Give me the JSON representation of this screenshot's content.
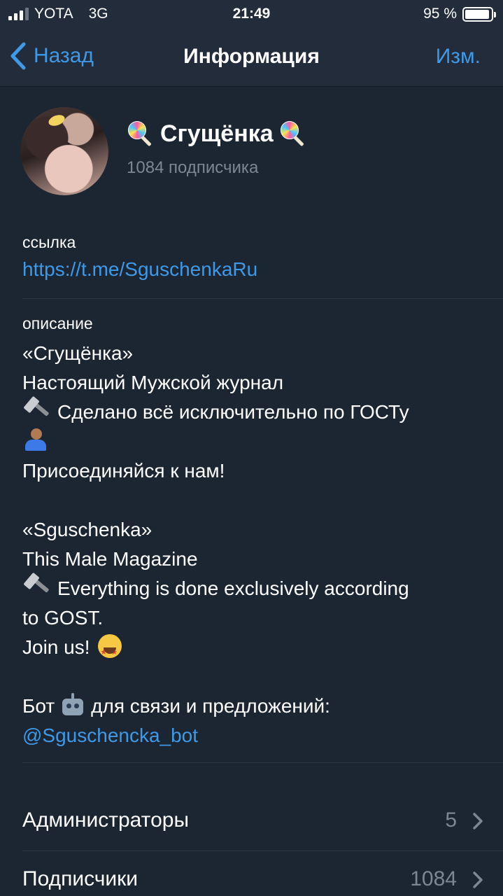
{
  "status_bar": {
    "carrier": "YOTA",
    "network": "3G",
    "time": "21:49",
    "battery_text": "95 %",
    "battery_level": 0.95,
    "signal_bars_filled": 3,
    "signal_bars_total": 4
  },
  "nav": {
    "back_label": "Назад",
    "title": "Информация",
    "edit_label": "Изм."
  },
  "channel": {
    "name": "Сгущёнка",
    "name_emoji_icon": "lollipop-icon",
    "subscribers_text": "1084 подписчика"
  },
  "link_section": {
    "label": "ссылка",
    "url": "https://t.me/SguschenkaRu"
  },
  "description_section": {
    "label": "описание",
    "lines": {
      "ru_title": "«Сгущёнка»",
      "ru_subtitle": "Настоящий Мужской журнал",
      "ru_made": "Сделано всё исключительно по ГОСТу",
      "ru_join": "Присоединяйся к нам!",
      "en_title": "«Sguschenka»",
      "en_subtitle": "This Male Magazine",
      "en_made_1": "Everything is done exclusively according",
      "en_made_2": "to GOST.",
      "en_join": "Join us!",
      "bot_prefix": "Бот",
      "bot_suffix": "для связи и предложений:",
      "bot_handle": "@Sguschencka_bot"
    },
    "icons": [
      "hammer-icon",
      "man-tipping-hand-icon",
      "star-struck-face-icon",
      "robot-icon"
    ]
  },
  "rows": [
    {
      "label": "Администраторы",
      "value": "5"
    },
    {
      "label": "Подписчики",
      "value": "1084"
    }
  ],
  "colors": {
    "background": "#1c2532",
    "bar": "#222c3a",
    "accent": "#3e9ae8",
    "secondary_text": "#7d8794"
  }
}
